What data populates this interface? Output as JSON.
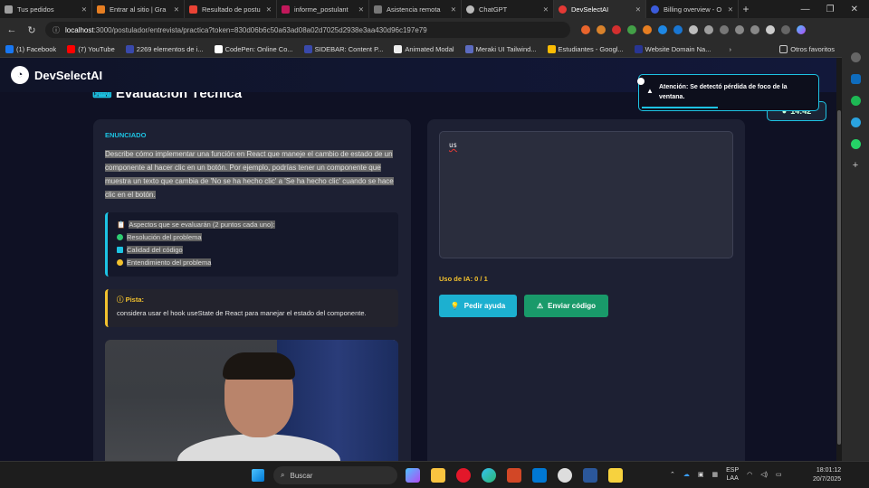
{
  "browser": {
    "tabs": [
      {
        "label": "Tus pedidos",
        "color": "#9e9e9e"
      },
      {
        "label": "Entrar al sitio | Gra",
        "color": "#e67e22"
      },
      {
        "label": "Resultado de postu",
        "color": "#ea4335"
      },
      {
        "label": "informe_postulant",
        "color": "#c2185b"
      },
      {
        "label": "Asistencia remota",
        "color": "#777777"
      },
      {
        "label": "ChatGPT",
        "color": "#bbbbbb"
      },
      {
        "label": "DevSelectAI",
        "color": "#e53935"
      },
      {
        "label": "Billing overview - O",
        "color": "#3b5bdb"
      }
    ],
    "url_host": "localhost",
    "url_path": ":3000/postulador/entrevista/practica?token=830d06b6c50a63ad08a02d7025d2938e3aa430d96c197e79",
    "bookmarks": [
      "(1) Facebook",
      "(7) YouTube",
      "2269 elementos de i...",
      "CodePen: Online Co...",
      "SIDEBAR: Content P...",
      "Animated Modal",
      "Meraki UI Tailwind...",
      "Estudiantes - Googl...",
      "Website Domain Na..."
    ],
    "other_bookmarks": "Otros favoritos",
    "bookmarks_chevron": "›"
  },
  "app": {
    "brand": "DevSelectAI",
    "page_title": "Evaluación Técnica",
    "section_label": "ENUNCIADO",
    "statement": "Describe cómo implementar una función en React que maneje el cambio de estado de un componente al hacer clic en un botón. Por ejemplo, podrías tener un componente que muestra un texto que cambia de 'No se ha hecho clic' a 'Se ha hecho clic' cuando se hace clic en el botón.",
    "criteria_title": "Aspectos que se evaluarán (2 puntos cada uno):",
    "criteria": [
      {
        "text": "Resolución del problema",
        "icon": "check-circle-icon",
        "color": "#2ecc71"
      },
      {
        "text": "Calidad del código",
        "icon": "code-icon",
        "color": "#1dc3e3"
      },
      {
        "text": "Entendimiento del problema",
        "icon": "lightbulb-icon",
        "color": "#f2c12e"
      }
    ],
    "hint_title": "Pista:",
    "hint_text": "considera usar el hook useState de React para manejar el estado del componente.",
    "editor_value": "us",
    "ai_usage": "Uso de IA: 0 / 1",
    "help_button": "Pedir ayuda",
    "send_button": "Enviar código",
    "timer": "14:42",
    "toast": "Atención: Se detectó pérdida de foco de la ventana."
  },
  "taskbar": {
    "search_label": "Buscar",
    "lang_1": "ESP",
    "lang_2": "LAA",
    "time": "18:01:12",
    "date": "20/7/2025"
  }
}
